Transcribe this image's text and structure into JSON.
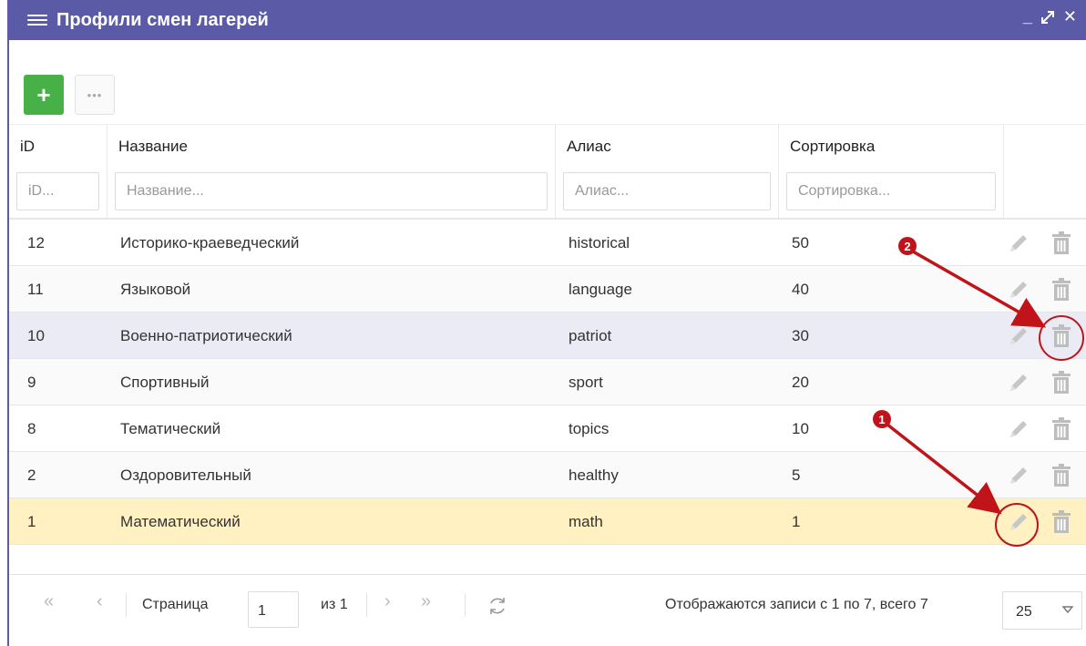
{
  "window": {
    "title": "Профили смен лагерей"
  },
  "toolbar": {
    "add_label": "+",
    "more_label": "•••"
  },
  "columns": {
    "id": {
      "label": "iD",
      "placeholder": "iD..."
    },
    "name": {
      "label": "Название",
      "placeholder": "Название..."
    },
    "alias": {
      "label": "Алиас",
      "placeholder": "Алиас..."
    },
    "sort": {
      "label": "Сортировка",
      "placeholder": "Сортировка..."
    }
  },
  "rows": [
    {
      "id": "12",
      "name": "Историко-краеведческий",
      "alias": "historical",
      "sort": "50"
    },
    {
      "id": "11",
      "name": "Языковой",
      "alias": "language",
      "sort": "40"
    },
    {
      "id": "10",
      "name": "Военно-патриотический",
      "alias": "patriot",
      "sort": "30"
    },
    {
      "id": "9",
      "name": "Спортивный",
      "alias": "sport",
      "sort": "20"
    },
    {
      "id": "8",
      "name": "Тематический",
      "alias": "topics",
      "sort": "10"
    },
    {
      "id": "2",
      "name": "Оздоровительный",
      "alias": "healthy",
      "sort": "5"
    },
    {
      "id": "1",
      "name": "Математический",
      "alias": "math",
      "sort": "1"
    }
  ],
  "pager": {
    "page_label": "Страница",
    "page_value": "1",
    "of_label": "из 1",
    "info": "Отображаются записи с 1 по 7, всего 7",
    "page_size": "25"
  },
  "annotations": {
    "marker1": "1",
    "marker2": "2"
  },
  "colors": {
    "titlebar": "#5a5aa6",
    "add_button": "#47b047",
    "highlight_row": "#eaebf5",
    "selected_row": "#fff1c2",
    "annotation": "#c0141a"
  }
}
